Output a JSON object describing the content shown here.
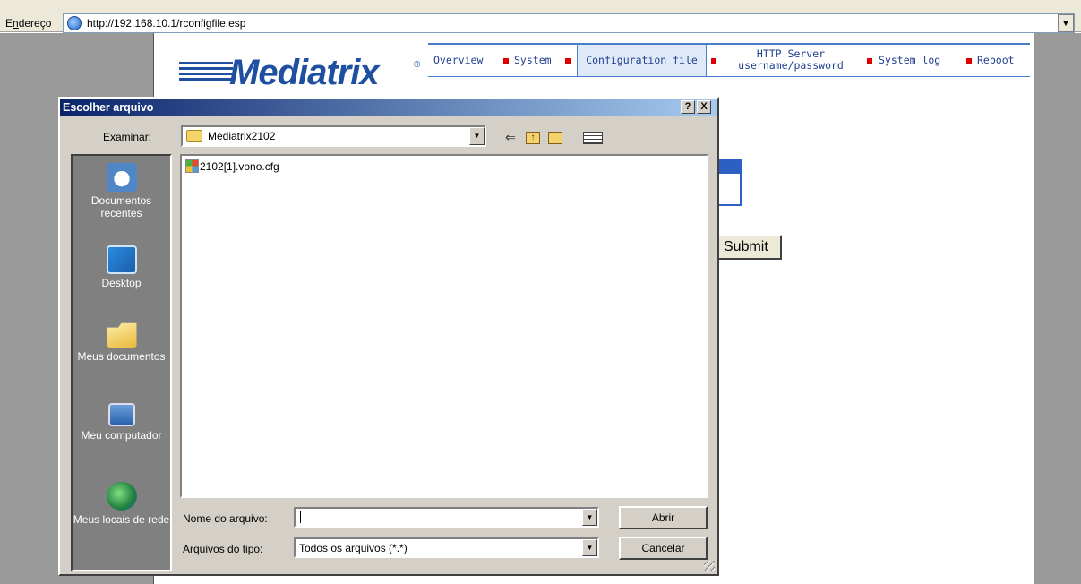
{
  "browser": {
    "address_label": "Endereço",
    "address_label_accel": "n",
    "url": "http://192.168.10.1/rconfigfile.esp"
  },
  "page": {
    "logo_text": "Mediatrix",
    "logo_reg": "®",
    "nav": {
      "overview": "Overview",
      "system": "System",
      "configuration_file": "Configuration file",
      "http_line1": "HTTP Server",
      "http_line2": "username/password",
      "system_log": "System log",
      "reboot": "Reboot"
    },
    "submit_label": "Submit"
  },
  "dialog": {
    "title": "Escolher arquivo",
    "help_label": "?",
    "close_label": "X",
    "look_in_label": "Examinar:",
    "look_in_value": "Mediatrix2102",
    "places": [
      {
        "label": "Documentos recentes",
        "icon": "recent-documents-icon"
      },
      {
        "label": "Desktop",
        "icon": "desktop-icon"
      },
      {
        "label": "Meus documentos",
        "icon": "my-documents-icon"
      },
      {
        "label": "Meu computador",
        "icon": "my-computer-icon"
      },
      {
        "label": "Meus locais de rede",
        "icon": "network-places-icon"
      }
    ],
    "files": [
      {
        "name": "2102[1].vono.cfg",
        "icon": "config-file-icon"
      }
    ],
    "file_name_label": "Nome do arquivo:",
    "file_name_value": "",
    "file_type_label": "Arquivos do tipo:",
    "file_type_value": "Todos os arquivos (*.*)",
    "open_label": "Abrir",
    "cancel_label": "Cancelar"
  },
  "colors": {
    "title_bar_start": "#0a246a",
    "title_bar_end": "#a6caf0",
    "brand_blue": "#1f4fa0",
    "nav_separator": "#dd0000"
  }
}
